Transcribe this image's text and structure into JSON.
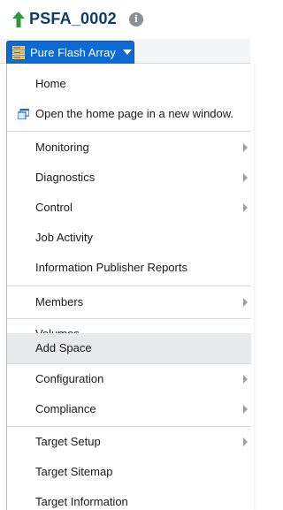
{
  "header": {
    "target_name": "PSFA_0002",
    "info_glyph": "i"
  },
  "menubar": {
    "button_label": "Pure Flash Array"
  },
  "menu": {
    "items": [
      {
        "label": "Home"
      },
      {
        "label": "Open the home page in a new window."
      },
      {
        "label": "Monitoring",
        "submenu": true
      },
      {
        "label": "Diagnostics",
        "submenu": true
      },
      {
        "label": "Control",
        "submenu": true
      },
      {
        "label": "Job Activity"
      },
      {
        "label": "Information Publisher Reports"
      },
      {
        "label": "Members",
        "submenu": true
      },
      {
        "label": "Volumes"
      },
      {
        "label": "Add Space",
        "hovered": true
      },
      {
        "label": "Configuration",
        "submenu": true
      },
      {
        "label": "Compliance",
        "submenu": true
      },
      {
        "label": "Target Setup",
        "submenu": true
      },
      {
        "label": "Target Sitemap"
      },
      {
        "label": "Target Information"
      }
    ]
  },
  "colors": {
    "accent": "#0d6ad1",
    "title": "#0c3c6c",
    "status_up": "#2a9a3c",
    "hover_bg": "#e8e9eb"
  },
  "icons": {
    "status": "up-arrow-icon",
    "info": "info-icon",
    "array": "storage-array-icon",
    "new_window": "new-window-icon",
    "submenu": "submenu-arrow-icon",
    "dropdown": "caret-down-icon"
  }
}
